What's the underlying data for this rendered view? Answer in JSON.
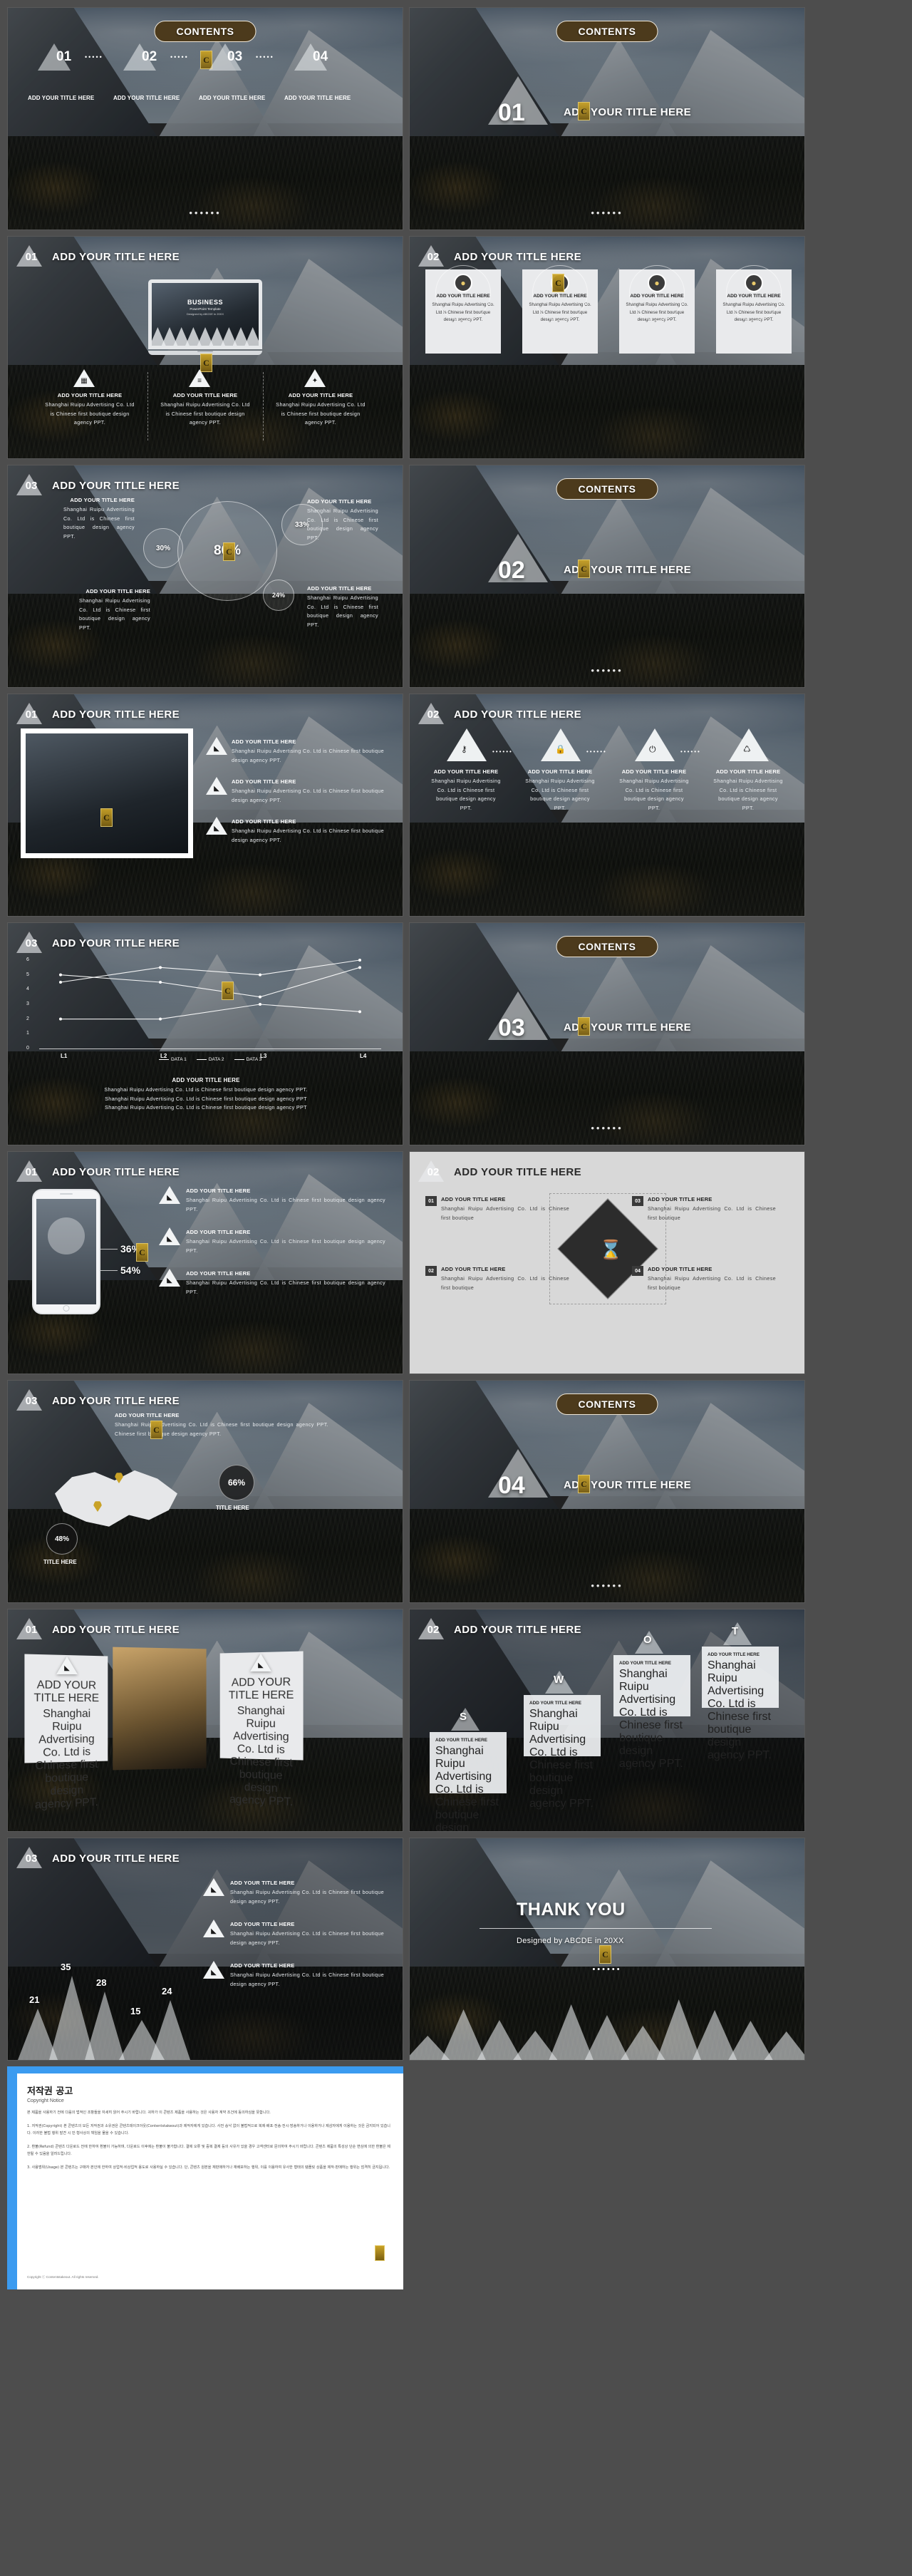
{
  "brand": {
    "logo_text": "C",
    "accent_gold": "#4c3a1c",
    "accent_blue": "#3b9bf0",
    "contents_label": "CONTENTS",
    "dots": "••••••"
  },
  "common": {
    "title_placeholder": "ADD YOUR TITLE HERE",
    "body_text": "Shanghai Ruipu Advertising Co. Ltd is Chinese first boutique design agency PPT.",
    "body_long": "Shanghai Ruipu Advertising Co. Ltd is Chinese first boutique design agency PPT."
  },
  "slides": [
    {
      "index": 1,
      "name": "contents-overview",
      "type": "contents-list",
      "header": "CONTENTS",
      "items": [
        {
          "num": "01",
          "label": "ADD YOUR TITLE HERE"
        },
        {
          "num": "02",
          "label": "ADD YOUR TITLE HERE"
        },
        {
          "num": "03",
          "label": "ADD YOUR TITLE HERE"
        },
        {
          "num": "04",
          "label": "ADD YOUR TITLE HERE"
        }
      ],
      "footer_dots": "••••••"
    },
    {
      "index": 2,
      "name": "section-divider-01",
      "type": "section",
      "header": "CONTENTS",
      "num": "01",
      "title": "ADD YOUR TITLE HERE",
      "footer_dots": "••••••"
    },
    {
      "index": 3,
      "name": "laptop-three-feature",
      "type": "laptop",
      "num": "01",
      "title": "ADD YOUR TITLE HERE",
      "laptop": {
        "title": "BUSINESS",
        "sub": "PowerPoint Template",
        "sub2": "Designed by ABCDE in 20XX"
      },
      "columns": [
        {
          "icon": "calendar-icon",
          "glyph": "▦",
          "title": "ADD YOUR TITLE HERE",
          "body": "Shanghai Ruipu Advertising Co. Ltd is Chinese first boutique design agency PPT."
        },
        {
          "icon": "sliders-icon",
          "glyph": "≡",
          "title": "ADD YOUR TITLE HERE",
          "body": "Shanghai Ruipu Advertising Co. Ltd is Chinese first boutique design agency PPT."
        },
        {
          "icon": "thumbs-up-icon",
          "glyph": "✦",
          "title": "ADD YOUR TITLE HERE",
          "body": "Shanghai Ruipu Advertising Co. Ltd is Chinese first boutique design agency PPT."
        }
      ]
    },
    {
      "index": 4,
      "name": "four-cards-avatars",
      "type": "cards4",
      "num": "02",
      "title": "ADD YOUR TITLE HERE",
      "cards": [
        {
          "icon": "user-icon",
          "title": "ADD YOUR TITLE HERE",
          "body": "Shanghai Ruipu Advertising Co. Ltd is Chinese first boutique design agency PPT."
        },
        {
          "icon": "user-icon",
          "title": "ADD YOUR TITLE HERE",
          "body": "Shanghai Ruipu Advertising Co. Ltd is Chinese first boutique design agency PPT."
        },
        {
          "icon": "user-icon",
          "title": "ADD YOUR TITLE HERE",
          "body": "Shanghai Ruipu Advertising Co. Ltd is Chinese first boutique design agency PPT."
        },
        {
          "icon": "user-icon",
          "title": "ADD YOUR TITLE HERE",
          "body": "Shanghai Ruipu Advertising Co. Ltd is Chinese first boutique design agency PPT."
        }
      ]
    },
    {
      "index": 5,
      "name": "bubble-percentages",
      "type": "bubbles",
      "num": "03",
      "title": "ADD YOUR TITLE HERE",
      "blocks": [
        {
          "title": "ADD YOUR TITLE HERE",
          "body": "Shanghai Ruipu Advertising Co. Ltd is Chinese first boutique design agency PPT."
        },
        {
          "title": "ADD YOUR TITLE HERE",
          "body": "Shanghai Ruipu Advertising Co. Ltd is Chinese first boutique design agency PPT."
        },
        {
          "title": "ADD YOUR TITLE HERE",
          "body": "Shanghai Ruipu Advertising Co. Ltd is Chinese first boutique design agency PPT."
        },
        {
          "title": "ADD YOUR TITLE HERE",
          "body": "Shanghai Ruipu Advertising Co. Ltd is Chinese first boutique design agency PPT."
        }
      ]
    },
    {
      "index": 6,
      "name": "section-divider-02",
      "type": "section",
      "header": "CONTENTS",
      "num": "02",
      "title": "ADD YOUR TITLE HERE",
      "footer_dots": "••••••"
    },
    {
      "index": 7,
      "name": "image-frame-list",
      "type": "framelist",
      "num": "01",
      "title": "ADD YOUR TITLE HERE",
      "rows": [
        {
          "icon": "flame-icon",
          "title": "ADD YOUR TITLE HERE",
          "body": "Shanghai Ruipu Advertising Co. Ltd is Chinese first boutique design agency PPT."
        },
        {
          "icon": "flame-icon",
          "title": "ADD YOUR TITLE HERE",
          "body": "Shanghai Ruipu Advertising Co. Ltd is Chinese first boutique design agency PPT."
        },
        {
          "icon": "flame-icon",
          "title": "ADD YOUR TITLE HERE",
          "body": "Shanghai Ruipu Advertising Co. Ltd is Chinese first boutique design agency PPT."
        }
      ]
    },
    {
      "index": 8,
      "name": "four-icon-timeline",
      "type": "icons4",
      "num": "02",
      "title": "ADD YOUR TITLE HERE",
      "items": [
        {
          "icon": "key-icon",
          "glyph": "⚷",
          "title": "ADD YOUR TITLE HERE",
          "body": "Shanghai Ruipu Advertising Co. Ltd is Chinese first boutique design agency PPT."
        },
        {
          "icon": "lock-icon",
          "glyph": "🔒",
          "title": "ADD YOUR TITLE HERE",
          "body": "Shanghai Ruipu Advertising Co. Ltd is Chinese first boutique design agency PPT."
        },
        {
          "icon": "power-icon",
          "glyph": "⏻",
          "title": "ADD YOUR TITLE HERE",
          "body": "Shanghai Ruipu Advertising Co. Ltd is Chinese first boutique design agency PPT."
        },
        {
          "icon": "recycle-icon",
          "glyph": "♺",
          "title": "ADD YOUR TITLE HERE",
          "body": "Shanghai Ruipu Advertising Co. Ltd is Chinese first boutique design agency PPT."
        }
      ],
      "separator_dots": "••••••"
    },
    {
      "index": 9,
      "name": "line-chart-slide",
      "type": "linechart",
      "num": "03",
      "title": "ADD YOUR TITLE HERE",
      "caption_title": "ADD YOUR TITLE HERE",
      "caption_lines": [
        "Shanghai Ruipu Advertising Co. Ltd is Chinese first boutique design agency PPT.",
        "Shanghai Ruipu Advertising Co. Ltd is Chinese first boutique design agency PPT",
        "Shanghai Ruipu Advertising Co. Ltd is Chinese first boutique design agency PPT"
      ]
    },
    {
      "index": 10,
      "name": "section-divider-03",
      "type": "section",
      "header": "CONTENTS",
      "num": "03",
      "title": "ADD YOUR TITLE HERE",
      "footer_dots": "••••••"
    },
    {
      "index": 11,
      "name": "phone-stats",
      "type": "phone",
      "num": "01",
      "title": "ADD YOUR TITLE HERE",
      "stats": [
        {
          "value": "36%"
        },
        {
          "value": "54%"
        }
      ],
      "blocks": [
        {
          "icon": "flame-icon",
          "title": "ADD YOUR TITLE HERE",
          "body": "Shanghai Ruipu Advertising Co. Ltd is Chinese first boutique design agency PPT."
        },
        {
          "icon": "flame-icon",
          "title": "ADD YOUR TITLE HERE",
          "body": "Shanghai Ruipu Advertising Co. Ltd is Chinese first boutique design agency PPT."
        },
        {
          "icon": "flame-icon",
          "title": "ADD YOUR TITLE HERE",
          "body": "Shanghai Ruipu Advertising Co. Ltd is Chinese first boutique design agency PPT."
        }
      ]
    },
    {
      "index": 12,
      "name": "diamond-four-quadrant",
      "type": "diamond",
      "num": "02",
      "title": "ADD YOUR TITLE HERE",
      "quadrants": [
        {
          "num": "01",
          "title": "ADD YOUR TITLE HERE",
          "body": "Shanghai Ruipu Advertising Co. Ltd is Chinese first boutique"
        },
        {
          "num": "03",
          "title": "ADD YOUR TITLE HERE",
          "body": "Shanghai Ruipu Advertising Co. Ltd is Chinese first boutique"
        },
        {
          "num": "02",
          "title": "ADD YOUR TITLE HERE",
          "body": "Shanghai Ruipu Advertising Co. Ltd is Chinese first boutique"
        },
        {
          "num": "04",
          "title": "ADD YOUR TITLE HERE",
          "body": "Shanghai Ruipu Advertising Co. Ltd is Chinese first boutique"
        }
      ],
      "center_icon": "hourglass-icon"
    },
    {
      "index": 13,
      "name": "map-slide",
      "type": "map",
      "num": "03",
      "title": "ADD YOUR TITLE HERE",
      "intro_title": "ADD YOUR TITLE HERE",
      "intro_body": "Shanghai Ruipu Advertising Co. Ltd is Chinese first boutique design agency PPT. Chinese first boutique design agency PPT.",
      "markers": [
        {
          "value": "66%",
          "label": "TITLE HERE"
        },
        {
          "value": "48%",
          "label": "TITLE HERE"
        }
      ]
    },
    {
      "index": 14,
      "name": "section-divider-04",
      "type": "section",
      "header": "CONTENTS",
      "num": "04",
      "title": "ADD YOUR TITLE HERE",
      "footer_dots": "••••••"
    },
    {
      "index": 15,
      "name": "two-photo-panels",
      "type": "panels2",
      "num": "01",
      "title": "ADD YOUR TITLE HERE",
      "panels": [
        {
          "icon": "flame-icon",
          "title": "ADD YOUR TITLE HERE",
          "body": "Shanghai Ruipu Advertising Co. Ltd is Chinese first boutique design agency PPT."
        },
        {
          "icon": "flame-icon",
          "title": "ADD YOUR TITLE HERE",
          "body": "Shanghai Ruipu Advertising Co. Ltd is Chinese first boutique design agency PPT."
        }
      ]
    },
    {
      "index": 16,
      "name": "swot-letters",
      "type": "swot",
      "num": "02",
      "title": "ADD YOUR TITLE HERE",
      "letters": [
        {
          "letter": "S",
          "title": "ADD YOUR TITLE HERE",
          "body": "Shanghai Ruipu Advertising Co. Ltd is Chinese first boutique design agency PPT."
        },
        {
          "letter": "W",
          "title": "ADD YOUR TITLE HERE",
          "body": "Shanghai Ruipu Advertising Co. Ltd is Chinese first boutique design agency PPT."
        },
        {
          "letter": "O",
          "title": "ADD YOUR TITLE HERE",
          "body": "Shanghai Ruipu Advertising Co. Ltd is Chinese first boutique design agency PPT."
        },
        {
          "letter": "T",
          "title": "ADD YOUR TITLE HERE",
          "body": "Shanghai Ruipu Advertising Co. Ltd is Chinese first boutique design agency PPT."
        }
      ]
    },
    {
      "index": 17,
      "name": "mountain-bar-chart",
      "type": "peakchart",
      "num": "03",
      "title": "ADD YOUR TITLE HERE",
      "blocks": [
        {
          "icon": "flame-icon",
          "title": "ADD YOUR TITLE HERE",
          "body": "Shanghai Ruipu Advertising Co. Ltd is Chinese first boutique design agency PPT."
        },
        {
          "icon": "flame-icon",
          "title": "ADD YOUR TITLE HERE",
          "body": "Shanghai Ruipu Advertising Co. Ltd is Chinese first boutique design agency PPT."
        },
        {
          "icon": "flame-icon",
          "title": "ADD YOUR TITLE HERE",
          "body": "Shanghai Ruipu Advertising Co. Ltd is Chinese first boutique design agency PPT."
        }
      ]
    },
    {
      "index": 18,
      "name": "thank-you",
      "type": "thankyou",
      "title": "THANK YOU",
      "subtitle": "Designed by ABCDE in 20XX",
      "footer_dots": "••••••"
    },
    {
      "index": 19,
      "name": "copyright-notice",
      "type": "copyright",
      "title_ko": "저작권 공고",
      "title_en": "Copyright Notice",
      "intro": "본 제품을 사용하기 전에 다음의 법적인 조항들을 자세히 읽어 주시기 바랍니다. 귀하가 이 콘텐츠 제품을 사용하는 것은 사용자 계약 조건에 동의하심을 뜻합니다.",
      "paragraphs": [
        "1. 저작권(Copyright) 본 콘텐츠의 모든 저작권과 소유권은 콘텐츠테이크아웃(Contentstakeout)과 제작자에게 있습니다. 사전 승낙 없이 불법적으로 복제·배포·전송·전시·방송하거나 이용하거나 제삼자에게 이용하는 것은 금지되어 있습니다. 이러한 불법 행위 발견 시 민·형사상의 책임을 물을 수 있습니다.",
        "2. 환불(Refund) 콘텐츠 다운로드 전에 한하여 환불이 가능하며, 다운로드 이후에는 환불이 불가합니다. 결제 오류 및 중복 결제 등의 사유가 있을 경우 고객센터로 문의하여 주시기 바랍니다. 콘텐츠 제품의 특성상 단순 변심에 의한 환불은 제한될 수 있음을 알려드립니다.",
        "3. 사용범위(Usage) 본 콘텐츠는 구매자 본인에 한하여 상업적·비상업적 용도로 사용하실 수 있습니다. 단, 콘텐츠 원본을 재판매하거나 재배포하는 행위, 이를 이용하여 유사한 형태의 템플릿 상품을 제작·판매하는 행위는 엄격히 금지됩니다."
      ],
      "footer": "Copyright ⓒ Contentstakeout. All rights reserved."
    }
  ],
  "chart_data": [
    {
      "type": "bubble",
      "slide": "bubble-percentages",
      "title": "ADD YOUR TITLE HERE",
      "labels": [
        "80%",
        "30%",
        "33%",
        "24%"
      ],
      "values": [
        80,
        30,
        33,
        24
      ],
      "ylabel": "",
      "xlabel": ""
    },
    {
      "type": "line",
      "slide": "line-chart-slide",
      "title": "",
      "categories": [
        "L1",
        "L2",
        "L3",
        "L4"
      ],
      "series": [
        {
          "name": "DATA 1",
          "values": [
            2,
            2,
            3,
            2.5
          ]
        },
        {
          "name": "DATA 2",
          "values": [
            5,
            4.5,
            3.5,
            5.5
          ]
        },
        {
          "name": "DATA 3",
          "values": [
            4.5,
            5.5,
            5,
            6
          ]
        }
      ],
      "yticks": [
        "0",
        "1",
        "2",
        "3",
        "4",
        "5",
        "6"
      ],
      "ylim": [
        0,
        6
      ],
      "legend": [
        "DATA 1",
        "DATA 2",
        "DATA 3"
      ],
      "legend_position": "bottom",
      "grid": false
    },
    {
      "type": "bar",
      "slide": "mountain-bar-chart",
      "title": "ADD YOUR TITLE HERE",
      "categories": [
        "",
        "",
        "",
        "",
        ""
      ],
      "values": [
        21,
        35,
        28,
        15,
        24
      ],
      "labels": [
        "21",
        "35",
        "28",
        "15",
        "24"
      ],
      "ylabel": "",
      "xlabel": ""
    },
    {
      "type": "pie",
      "slide": "phone-stats",
      "title": "ADD YOUR TITLE HERE",
      "labels": [
        "36%",
        "54%"
      ],
      "values": [
        36,
        54
      ]
    },
    {
      "type": "table",
      "slide": "map-slide",
      "title": "ADD YOUR TITLE HERE",
      "categories": [
        "TITLE HERE",
        "TITLE HERE"
      ],
      "values": [
        66,
        48
      ],
      "labels": [
        "66%",
        "48%"
      ]
    }
  ]
}
